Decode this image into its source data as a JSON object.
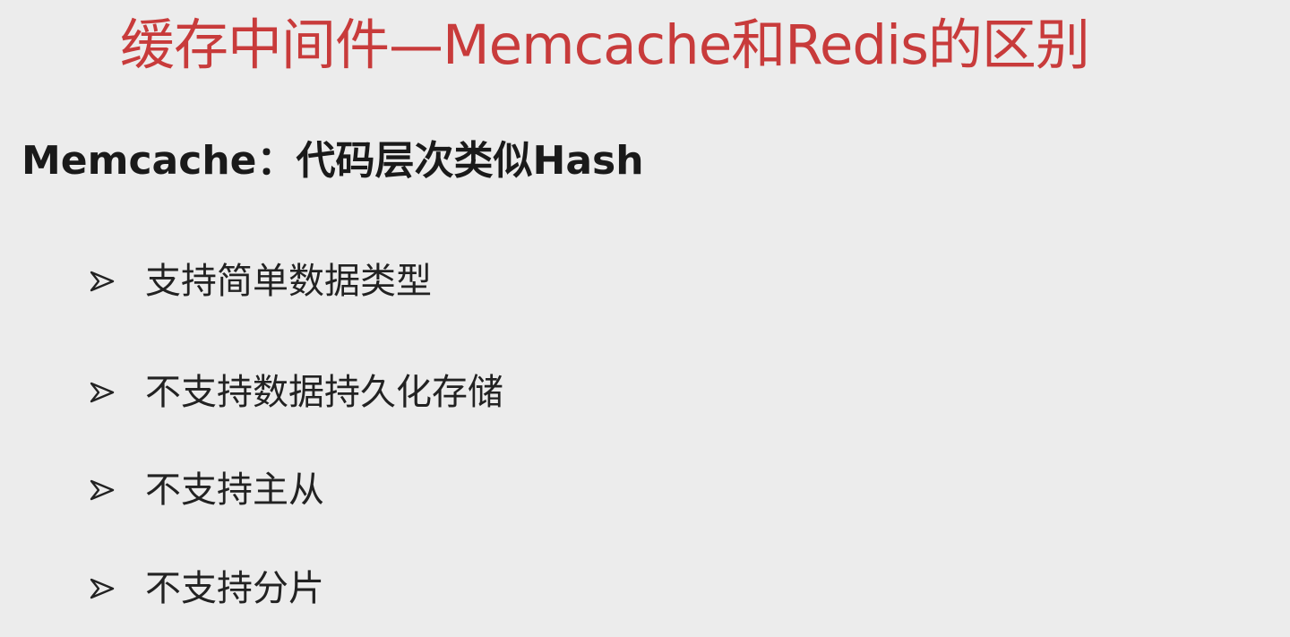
{
  "slide": {
    "title": "缓存中间件—Memcache和Redis的区别",
    "subtitle": "Memcache：代码层次类似Hash",
    "bullets": [
      {
        "label": "支持简单数据类型",
        "icon": "arrowhead-bullet-icon"
      },
      {
        "label": "不支持数据持久化存储",
        "icon": "arrowhead-bullet-icon"
      },
      {
        "label": "不支持主从",
        "icon": "arrowhead-bullet-icon"
      },
      {
        "label": "不支持分片",
        "icon": "arrowhead-bullet-icon"
      }
    ],
    "colors": {
      "background": "#ececec",
      "title": "#c83b3b",
      "text": "#222222"
    }
  }
}
